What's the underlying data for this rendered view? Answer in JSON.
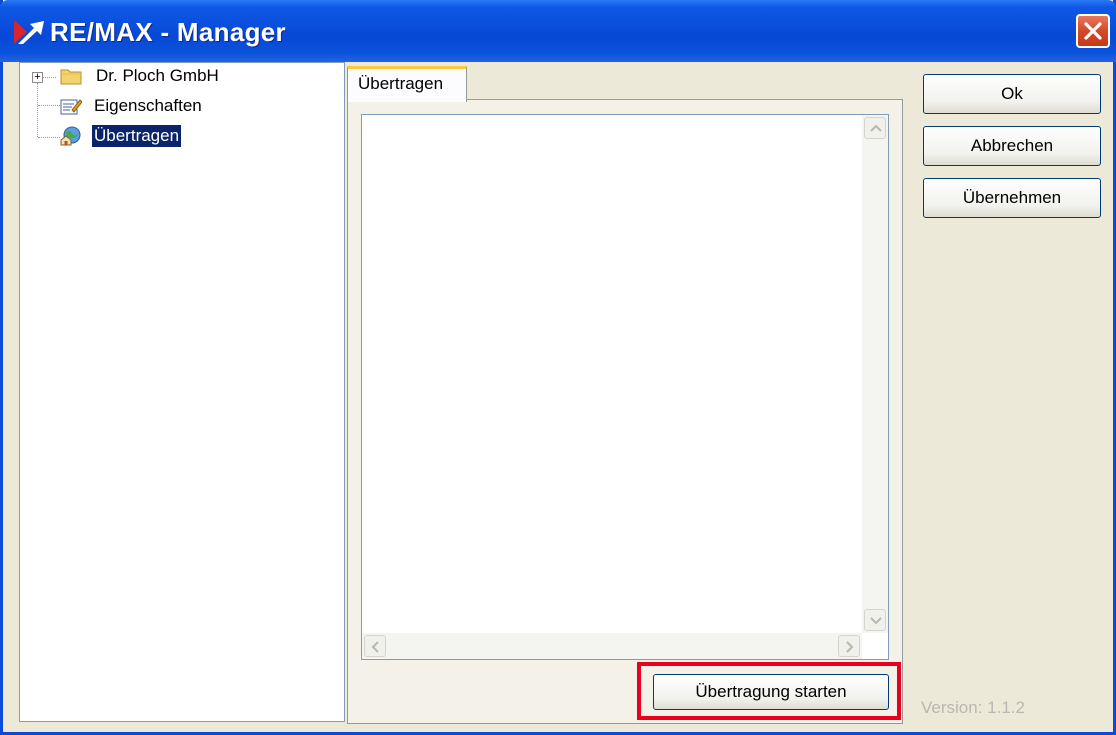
{
  "window": {
    "title": "RE/MAX - Manager"
  },
  "tree": {
    "items": [
      {
        "label": "Dr. Ploch GmbH"
      },
      {
        "label": "Eigenschaften"
      },
      {
        "label": "Übertragen"
      }
    ]
  },
  "tab": {
    "label": "Übertragen"
  },
  "textarea": {
    "value": ""
  },
  "buttons": {
    "ok": "Ok",
    "cancel": "Abbrechen",
    "apply": "Übernehmen",
    "start_transfer": "Übertragung starten"
  },
  "footer": {
    "version": "Version: 1.1.2"
  },
  "colors": {
    "highlight": "#e8001e",
    "titlebar": "#0748d6",
    "selection": "#0a246a"
  }
}
